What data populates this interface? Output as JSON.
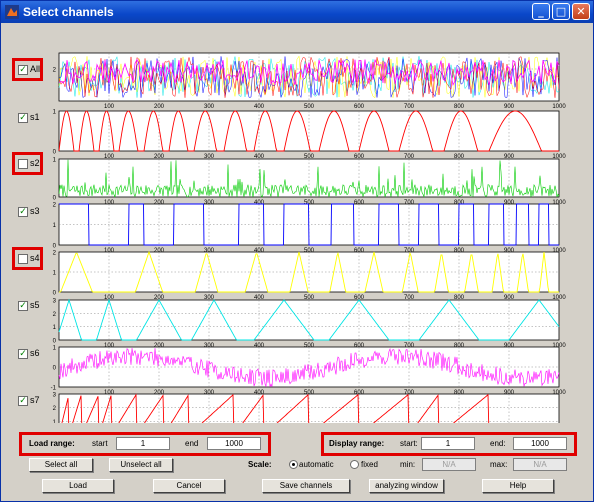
{
  "window": {
    "title": "Select channels",
    "controls": {
      "minimize": "_",
      "maximize": "□",
      "close": "✕"
    }
  },
  "channels": [
    {
      "label": "All",
      "checked": true,
      "highlighted": true,
      "yticks": [
        "2"
      ],
      "ylim": [
        0,
        3
      ]
    },
    {
      "label": "s1",
      "checked": true,
      "highlighted": false,
      "yticks": [
        "0",
        "1"
      ],
      "ylim": [
        0,
        1
      ]
    },
    {
      "label": "s2",
      "checked": false,
      "highlighted": true,
      "yticks": [
        "0",
        "1"
      ],
      "ylim": [
        0,
        1
      ]
    },
    {
      "label": "s3",
      "checked": true,
      "highlighted": false,
      "yticks": [
        "0",
        "1",
        "2"
      ],
      "ylim": [
        0,
        2
      ]
    },
    {
      "label": "s4",
      "checked": false,
      "highlighted": true,
      "yticks": [
        "0",
        "1",
        "2"
      ],
      "ylim": [
        0,
        2
      ]
    },
    {
      "label": "s5",
      "checked": true,
      "highlighted": false,
      "yticks": [
        "0",
        "1",
        "2",
        "3"
      ],
      "ylim": [
        0,
        3
      ]
    },
    {
      "label": "s6",
      "checked": true,
      "highlighted": false,
      "yticks": [
        "-1",
        "0",
        "1"
      ],
      "ylim": [
        -1,
        1
      ]
    },
    {
      "label": "s7",
      "checked": true,
      "highlighted": false,
      "yticks": [
        "0",
        "1",
        "2",
        "3"
      ],
      "ylim": [
        0,
        3
      ]
    }
  ],
  "xaxis": {
    "ticks": [
      "100",
      "200",
      "300",
      "400",
      "500",
      "600",
      "700",
      "800",
      "900",
      "1000"
    ],
    "xlim": [
      0,
      1000
    ]
  },
  "load_range": {
    "label": "Load range:",
    "start_label": "start",
    "start_value": "1",
    "end_label": "end",
    "end_value": "1000"
  },
  "display_range": {
    "label": "Display range:",
    "start_label": "start:",
    "start_value": "1",
    "end_label": "end:",
    "end_value": "1000"
  },
  "selection": {
    "select_all": "Select all",
    "unselect_all": "Unselect all"
  },
  "scale": {
    "label": "Scale:",
    "automatic": "automatic",
    "fixed": "fixed",
    "selected": "automatic",
    "min_label": "min:",
    "min_value": "N/A",
    "max_label": "max:",
    "max_value": "N/A"
  },
  "buttons": {
    "load": "Load",
    "cancel": "Cancel",
    "save_channels": "Save channels",
    "analyzing_window": "analyzing window",
    "help": "Help"
  },
  "colors": {
    "all": "#ff00ff",
    "s1": "#ff0000",
    "s2": "#00cc00",
    "s3": "#0000ff",
    "s4": "#ffff00",
    "s5": "#00e5e5",
    "s6": "#ff00ff",
    "s7": "#ff0000",
    "highlight": "#e00000"
  }
}
